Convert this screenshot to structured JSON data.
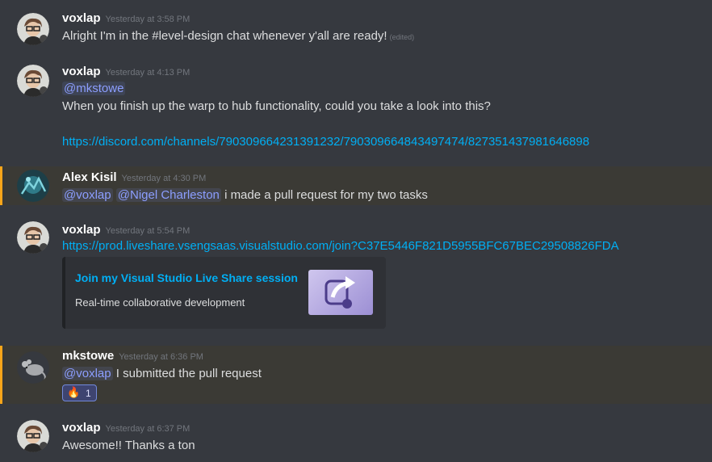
{
  "colors": {
    "background": "#36393f",
    "mention_highlight": "#3b3a35",
    "mention_bar": "#faa61a",
    "link": "#00aff4",
    "ping_text": "#8c9eff"
  },
  "messages": [
    {
      "author": "voxlap",
      "timestamp": "Yesterday at 3:58 PM",
      "text": "Alright I'm in the #level-design chat whenever y'all are ready!",
      "edited_label": "(edited)"
    },
    {
      "author": "voxlap",
      "timestamp": "Yesterday at 4:13 PM",
      "mention": "@mkstowe",
      "text": "When you finish up the warp to hub functionality, could you take a look into this?",
      "link": "https://discord.com/channels/790309664231391232/790309664843497474/827351437981646898"
    },
    {
      "author": "Alex Kisil",
      "timestamp": "Yesterday at 4:30 PM",
      "mention_1": "@voxlap",
      "mention_2": "@Nigel Charleston",
      "text": "i made a pull request for my two tasks"
    },
    {
      "author": "voxlap",
      "timestamp": "Yesterday at 5:54 PM",
      "link": "https://prod.liveshare.vsengsaas.visualstudio.com/join?C37E5446F821D5955BFC67BEC29508826FDA",
      "embed": {
        "title": "Join my Visual Studio Live Share session",
        "description": "Real-time collaborative development",
        "thumbnail_icon": "share-arrow-icon"
      }
    },
    {
      "author": "mkstowe",
      "timestamp": "Yesterday at 6:36 PM",
      "mention": "@voxlap",
      "text": "I submitted the pull request",
      "reaction": {
        "emoji": "🔥",
        "count": "1"
      }
    },
    {
      "author": "voxlap",
      "timestamp": "Yesterday at 6:37 PM",
      "text": "Awesome!! Thanks a ton"
    }
  ]
}
